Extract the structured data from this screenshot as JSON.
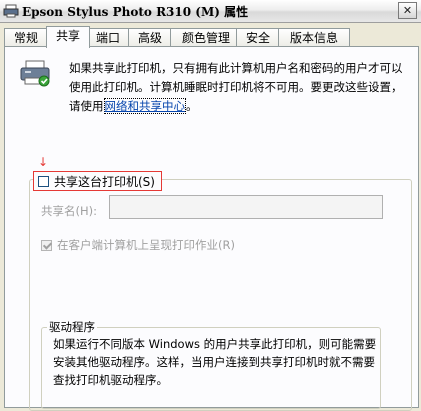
{
  "window": {
    "title": "Epson Stylus Photo R310 (M) 属性",
    "close_glyph": "✕"
  },
  "tabs": [
    {
      "label": "常规",
      "active": false
    },
    {
      "label": "共享",
      "active": true
    },
    {
      "label": "端口",
      "active": false
    },
    {
      "label": "高级",
      "active": false
    },
    {
      "label": "颜色管理",
      "active": false
    },
    {
      "label": "安全",
      "active": false
    },
    {
      "label": "版本信息",
      "active": false
    }
  ],
  "sharing": {
    "intro_text": "如果共享此打印机，只有拥有此计算机用户名和密码的用户才可以使用此打印机。计算机睡眠时打印机将不可用。要更改这些设置，请使用",
    "intro_link": "网络和共享中心",
    "intro_end": "。",
    "arrow_glyph": "↓",
    "share_checkbox_label": "共享这台打印机(S)",
    "share_checked": false,
    "share_name_label": "共享名(H):",
    "share_name_value": "",
    "render_checkbox_label": "在客户端计算机上呈现打印作业(R)",
    "render_checked": true,
    "drivers_title": "驱动程序",
    "drivers_text": "如果运行不同版本 Windows 的用户共享此打印机，则可能需要安装其他驱动程序。这样，当用户连接到共享打印机时就不需要查找打印机驱动程序。"
  },
  "colors": {
    "accent_red": "#E53935",
    "link_blue": "#0645AD"
  },
  "icons": [
    "printer-icon",
    "title-printer-icon",
    "close-icon",
    "red-arrow-icon"
  ]
}
